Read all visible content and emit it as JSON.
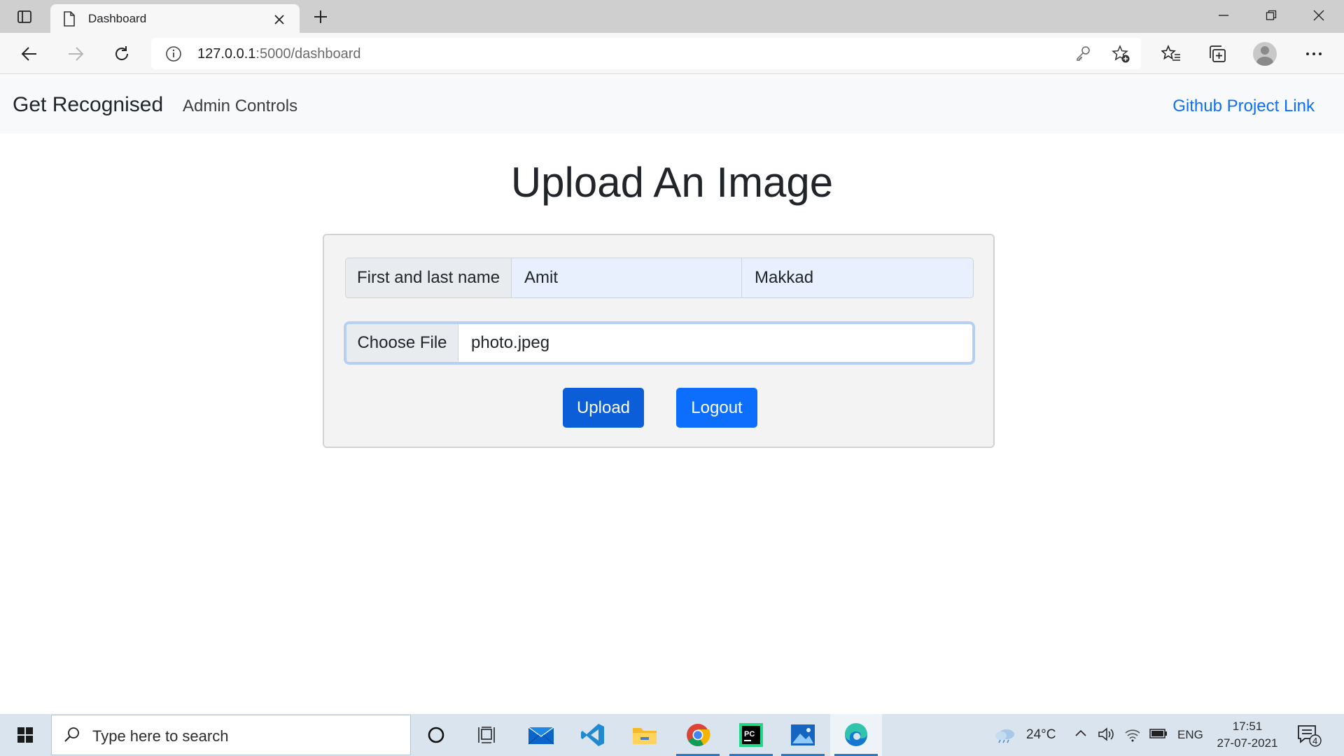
{
  "browser": {
    "tab_title": "Dashboard",
    "url_host": "127.0.0.1",
    "url_path": ":5000/dashboard"
  },
  "navbar": {
    "brand": "Get Recognised",
    "admin_link": "Admin Controls",
    "github_link": "Github Project Link"
  },
  "main": {
    "title": "Upload An Image",
    "name_label": "First and last name",
    "first_name": "Amit",
    "last_name": "Makkad",
    "file_button": "Choose File",
    "file_name": "photo.jpeg",
    "upload_button": "Upload",
    "logout_button": "Logout"
  },
  "taskbar": {
    "search_placeholder": "Type here to search",
    "temperature": "24°C",
    "language": "ENG",
    "time": "17:51",
    "date": "27-07-2021",
    "notification_count": "4"
  },
  "colors": {
    "primary": "#0d6efd",
    "navbar_bg": "#f8f9fa",
    "autofill_bg": "#e8f0fe"
  }
}
